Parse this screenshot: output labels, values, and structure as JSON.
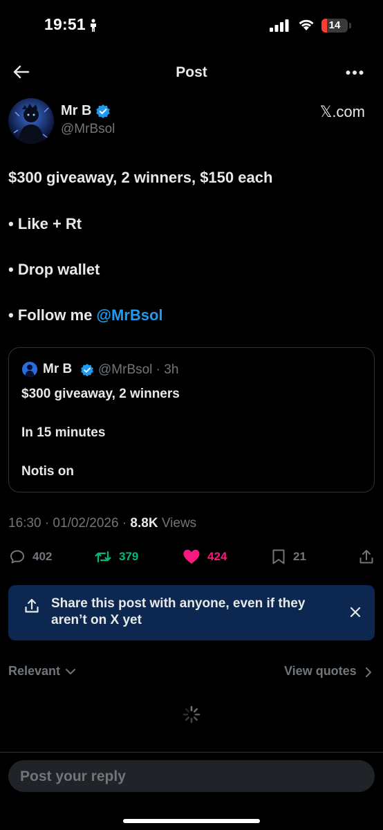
{
  "status_bar": {
    "time": "19:51",
    "battery": "14"
  },
  "header": {
    "title": "Post"
  },
  "author": {
    "name": "Mr B",
    "handle": "@MrBsol",
    "source": "𝕏.com"
  },
  "post": {
    "line1": "$300 giveaway, 2 winners, $150 each",
    "line2": "• Like + Rt",
    "line3": "• Drop wallet",
    "line4_prefix": "• Follow me ",
    "line4_mention": "@MrBsol"
  },
  "quote": {
    "name": "Mr B",
    "meta": "@MrBsol · 3h",
    "line1": "$300 giveaway, 2 winners",
    "line2": "In 15 minutes",
    "line3": "Notis on"
  },
  "meta": {
    "timestamp": "16:30 · 01/02/2026 · ",
    "views_count": "8.8K",
    "views_label": " Views"
  },
  "actions": {
    "replies": "402",
    "reposts": "379",
    "likes": "424",
    "bookmarks": "21"
  },
  "colors": {
    "accent": "#1d9bf0",
    "repost": "#00ba7c",
    "like": "#f91880",
    "banner": "#0c2750"
  },
  "share_banner": {
    "text": "Share this post with anyone, even if they aren’t on X yet"
  },
  "filters": {
    "sort": "Relevant",
    "view_quotes": "View quotes"
  },
  "reply": {
    "placeholder": "Post your reply"
  }
}
